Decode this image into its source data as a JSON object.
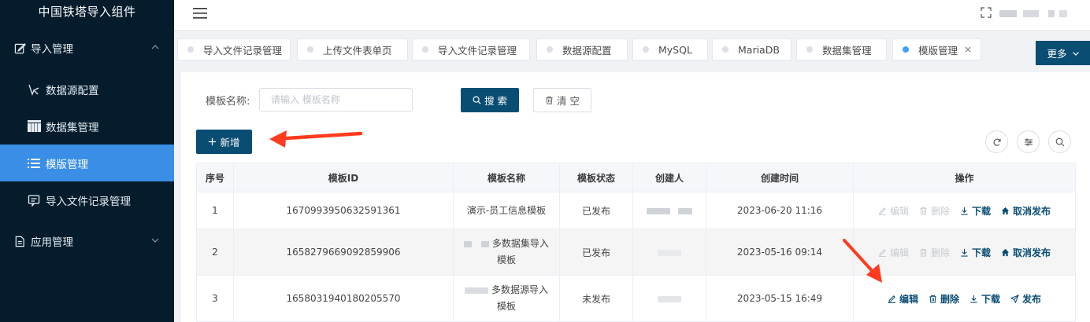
{
  "app": {
    "title": "中国铁塔导入组件"
  },
  "sidebar": {
    "groups": [
      {
        "label": "导入管理",
        "icon": "edit-icon",
        "expanded": true,
        "items": [
          {
            "label": "数据源配置",
            "icon": "data-source-icon",
            "active": false
          },
          {
            "label": "数据集管理",
            "icon": "dataset-icon",
            "active": false
          },
          {
            "label": "模版管理",
            "icon": "list-icon",
            "active": true
          },
          {
            "label": "导入文件记录管理",
            "icon": "file-record-icon",
            "active": false
          }
        ]
      },
      {
        "label": "应用管理",
        "icon": "document-icon",
        "expanded": false,
        "items": []
      }
    ]
  },
  "tabs": [
    {
      "label": "导入文件记录管理",
      "active": false
    },
    {
      "label": "上传文件表单页",
      "active": false
    },
    {
      "label": "导入文件记录管理",
      "active": false
    },
    {
      "label": "数据源配置",
      "active": false
    },
    {
      "label": "MySQL",
      "active": false
    },
    {
      "label": "MariaDB",
      "active": false
    },
    {
      "label": "数据集管理",
      "active": false
    },
    {
      "label": "模版管理",
      "active": true,
      "close": "×"
    }
  ],
  "more_button": "更多",
  "search": {
    "label": "模板名称:",
    "placeholder": "请输入 模板名称",
    "search_button": "搜 索",
    "clear_button": "清 空"
  },
  "add_button": "新增",
  "table": {
    "headers": [
      "序号",
      "模板ID",
      "模板名称",
      "模板状态",
      "创建人",
      "创建时间",
      "操作"
    ],
    "rows": [
      {
        "index": "1",
        "id": "1670993950632591361",
        "name_line1": "演示-员工信息模板",
        "name_line2": "",
        "status": "已发布",
        "created": "2023-06-20 11:16",
        "ops": {
          "edit": "编辑",
          "delete": "删除",
          "download": "下载",
          "publish": "取消发布"
        },
        "editable": false
      },
      {
        "index": "2",
        "id": "1658279669092859906",
        "name_line1": "多数据集导入",
        "name_line2": "模板",
        "status": "已发布",
        "created": "2023-05-16 09:14",
        "ops": {
          "edit": "编辑",
          "delete": "删除",
          "download": "下载",
          "publish": "取消发布"
        },
        "editable": false
      },
      {
        "index": "3",
        "id": "1658031940180205570",
        "name_line1": "多数据源导入",
        "name_line2": "模板",
        "status": "未发布",
        "created": "2023-05-15 16:49",
        "ops": {
          "edit": "编辑",
          "delete": "删除",
          "download": "下载",
          "publish": "发布"
        },
        "editable": true
      }
    ]
  },
  "colors": {
    "sidebar_bg": "#041c2c",
    "active_menu": "#3a8ee6",
    "primary": "#0a4d73",
    "arrow": "#ff3b1f"
  }
}
